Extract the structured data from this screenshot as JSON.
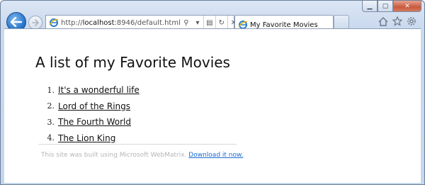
{
  "window": {
    "caption_buttons": [
      "minimize",
      "maximize",
      "close"
    ]
  },
  "navbar": {
    "url_prefix": "http://",
    "url_host": "localhost",
    "url_rest": ":8946/default.html"
  },
  "tab": {
    "title": "My Favorite Movies"
  },
  "page": {
    "heading": "A list of my Favorite Movies",
    "movies": [
      {
        "number": "1.",
        "title": "It's a wonderful life"
      },
      {
        "number": "2.",
        "title": "Lord of the Rings"
      },
      {
        "number": "3.",
        "title": "The Fourth World"
      },
      {
        "number": "4.",
        "title": "The Lion King"
      }
    ],
    "footer_text": "This site was built using Microsoft WebMatrix.",
    "footer_link": "Download it now."
  },
  "colors": {
    "link": "#1a6bd1",
    "back_button": "#1f6fc7",
    "close_button": "#c75a3e"
  }
}
